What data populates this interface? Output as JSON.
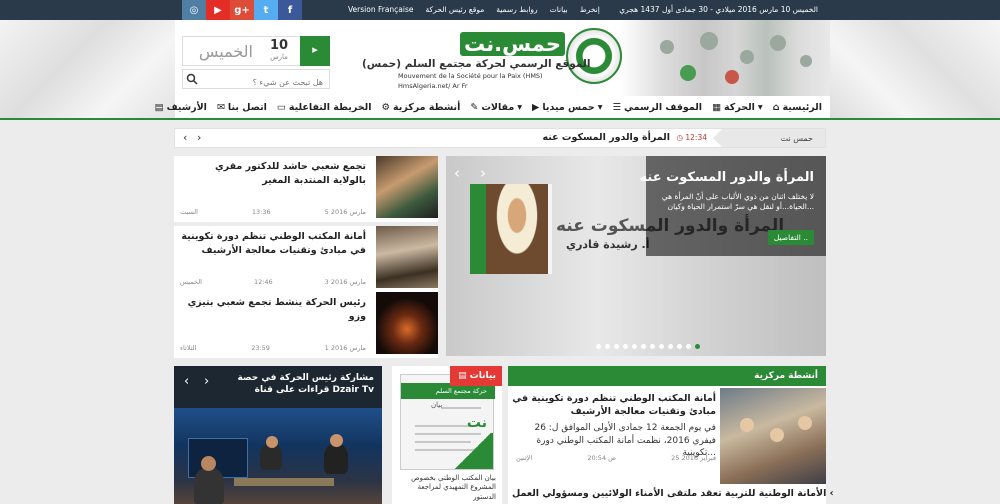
{
  "topbar": {
    "date": "الخميس 10 مارس 2016 ميلادي - 30 جمادى أول 1437 هجري",
    "links": [
      "إنخرط",
      "بيانات",
      "روابط رسمية",
      "موقع رئيس الحركة",
      "Version Française"
    ],
    "socials": [
      {
        "icon": "facebook-icon",
        "glyph": "f",
        "color": "#3b5998"
      },
      {
        "icon": "twitter-icon",
        "glyph": "t",
        "color": "#55acee"
      },
      {
        "icon": "googleplus-icon",
        "glyph": "g+",
        "color": "#dd4b39"
      },
      {
        "icon": "youtube-icon",
        "glyph": "▶",
        "color": "#e52d27"
      },
      {
        "icon": "instagram-icon",
        "glyph": "◎",
        "color": "#517fa4"
      }
    ]
  },
  "header": {
    "site_name": "حمس.نت",
    "subtitle": "الموقع الرسمي لحركة مجتمع السلم (حمس)",
    "french_name": "Mouvement de la Société pour la Paix (HMS)",
    "links_line": "HmsAlgeria.net/ Ar Fr",
    "date_widget": {
      "day_name": "الخميس",
      "day_number": "10",
      "month": "مارس"
    },
    "search_placeholder": "هل تبحث عن شيء ؟"
  },
  "nav": [
    {
      "label": "الرئيسية",
      "icon": "home-icon",
      "glyph": "⌂"
    },
    {
      "label": "الحركة",
      "icon": "grid-icon",
      "glyph": "▦",
      "dropdown": true
    },
    {
      "label": "الموقف الرسمي",
      "icon": "list-icon",
      "glyph": "☰"
    },
    {
      "label": "حمس ميديا",
      "icon": "play-icon",
      "glyph": "▶",
      "dropdown": true
    },
    {
      "label": "مقالات",
      "icon": "pencil-icon",
      "glyph": "✎",
      "dropdown": true
    },
    {
      "label": "أنشطة مركزية",
      "icon": "gear-icon",
      "glyph": "⚙"
    },
    {
      "label": "الخريطة التفاعلية",
      "icon": "monitor-icon",
      "glyph": "▭"
    },
    {
      "label": "اتصل بنا",
      "icon": "envelope-icon",
      "glyph": "✉"
    },
    {
      "label": "الأرشيف",
      "icon": "book-icon",
      "glyph": "▤"
    }
  ],
  "ticker": {
    "label": "حمس نت",
    "time": "12:34",
    "headline": "المرأة والدور المسكوت عنه"
  },
  "slider": {
    "title": "المرأة والدور المسكوت عنه",
    "excerpt": "لا يختلف اثنان من ذوي الألباب على أنّ المرأة هي الحياة...أو لنقل هي سرّ استمرار الحياة وكيان...",
    "more": "التفاصيل ..",
    "image_caption": "المرأة والدور المسكوت عنه",
    "image_name": "أ. رشيدة قادري",
    "total_slides": 12,
    "active_slide": 12
  },
  "side_news": [
    {
      "title": "تجمع شعبي حاشد للدكتور مقري بالولاية المنتدبة المغير",
      "date": "5 مارس 2016",
      "time": "13:36",
      "day": "السبت"
    },
    {
      "title": "أمانة المكتب الوطني تنظم دورة تكوينية في مبادئ وتقنيات معالجة الأرشيف",
      "date": "3 مارس 2016",
      "time": "12:46",
      "day": "الخميس"
    },
    {
      "title": "رئيس الحركة ينشط تجمع شعبي بتيزي وزو",
      "date": "1 مارس 2016",
      "time": "23:59",
      "day": "الثلاثاء"
    }
  ],
  "featured": {
    "section": "أنشطة مركزية",
    "title": "أمانة المكتب الوطني تنظم دورة تكوينية في مبادئ وتقنيات معالجة الأرشيف",
    "excerpt": "في يوم الجمعة 12 جمادى الأولى الموافق ل: 26 فيفري 2016، نظمت أمانة المكتب الوطني دورة تكوينية...",
    "date": "25 فبراير 2016",
    "time": "20:54 ص",
    "day": "الإثنين",
    "next_title": "الأمانة الوطنية للتربية تعقد ملتقى الأمناء الولائيين ومسؤولي العمل"
  },
  "statements": {
    "section": "بيانات",
    "doc_header": "حركة مجتمع السلم",
    "doc_word": "بيان",
    "doc_net": "نت",
    "caption": "بيان المكتب الوطني بخصوص المشروع التمهيدي لمراجعة الدستور"
  },
  "video": {
    "title": "مشاركة رئيس الحركة في حصة قراءات على قناة Dzair Tv"
  }
}
